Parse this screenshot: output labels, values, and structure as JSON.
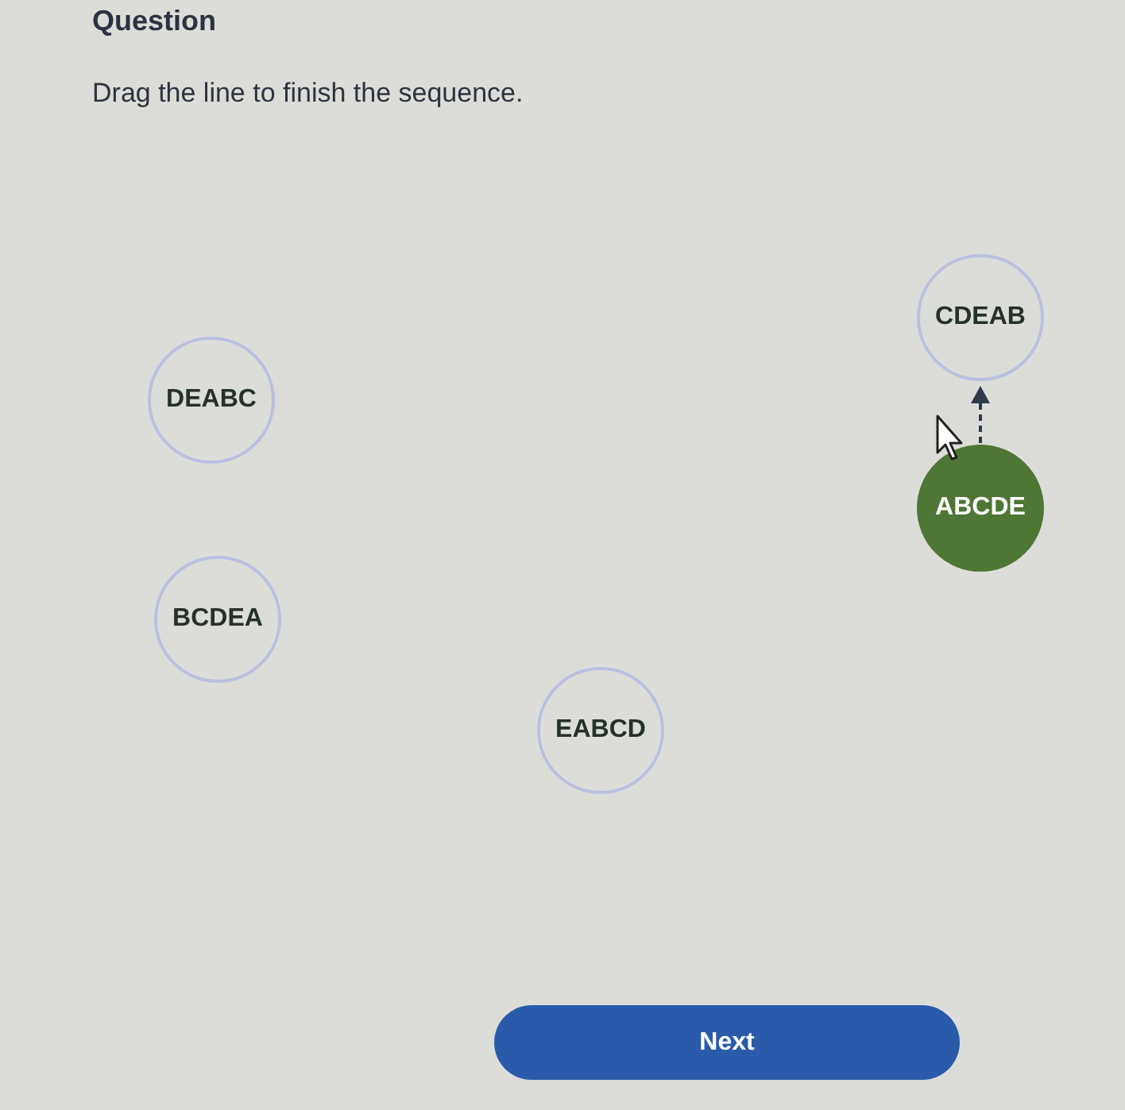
{
  "header": {
    "title": "Question",
    "instruction": "Drag the line to finish the sequence."
  },
  "nodes": [
    {
      "label": "CDEAB",
      "selected": false,
      "drag_line": false
    },
    {
      "label": "DEABC",
      "selected": false,
      "drag_line": false
    },
    {
      "label": "ABCDE",
      "selected": true,
      "drag_line": true
    },
    {
      "label": "BCDEA",
      "selected": false,
      "drag_line": false
    },
    {
      "label": "EABCD",
      "selected": false,
      "drag_line": false
    }
  ],
  "buttons": [
    {
      "label": "Next"
    }
  ]
}
